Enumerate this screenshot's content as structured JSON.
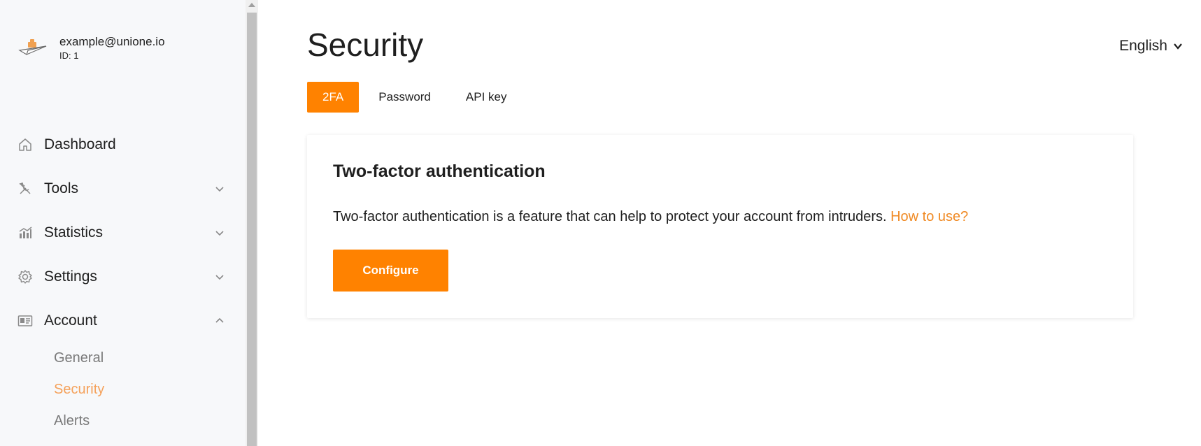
{
  "user": {
    "email": "example@unione.io",
    "id_label": "ID: 1",
    "avatar_icon": "paper-plane-icon"
  },
  "sidebar": {
    "items": [
      {
        "label": "Dashboard",
        "icon": "home-icon"
      },
      {
        "label": "Tools",
        "icon": "tools-icon",
        "expandable": true,
        "expanded": false
      },
      {
        "label": "Statistics",
        "icon": "statistics-icon",
        "expandable": true,
        "expanded": false
      },
      {
        "label": "Settings",
        "icon": "gear-icon",
        "expandable": true,
        "expanded": false
      },
      {
        "label": "Account",
        "icon": "id-card-icon",
        "expandable": true,
        "expanded": true
      }
    ],
    "account_subitems": [
      {
        "label": "General",
        "active": false
      },
      {
        "label": "Security",
        "active": true
      },
      {
        "label": "Alerts",
        "active": false
      }
    ]
  },
  "header": {
    "title": "Security",
    "language": "English"
  },
  "tabs": [
    {
      "label": "2FA",
      "active": true
    },
    {
      "label": "Password",
      "active": false
    },
    {
      "label": "API key",
      "active": false
    }
  ],
  "card": {
    "title": "Two-factor authentication",
    "description": "Two-factor authentication is a feature that can help to protect your account from intruders.",
    "link_text": "How to use?",
    "button_label": "Configure"
  },
  "colors": {
    "accent": "#ff8200",
    "link": "#f08a24",
    "active_subnav": "#f5a15a",
    "sidebar_bg": "#f7f8fa"
  }
}
